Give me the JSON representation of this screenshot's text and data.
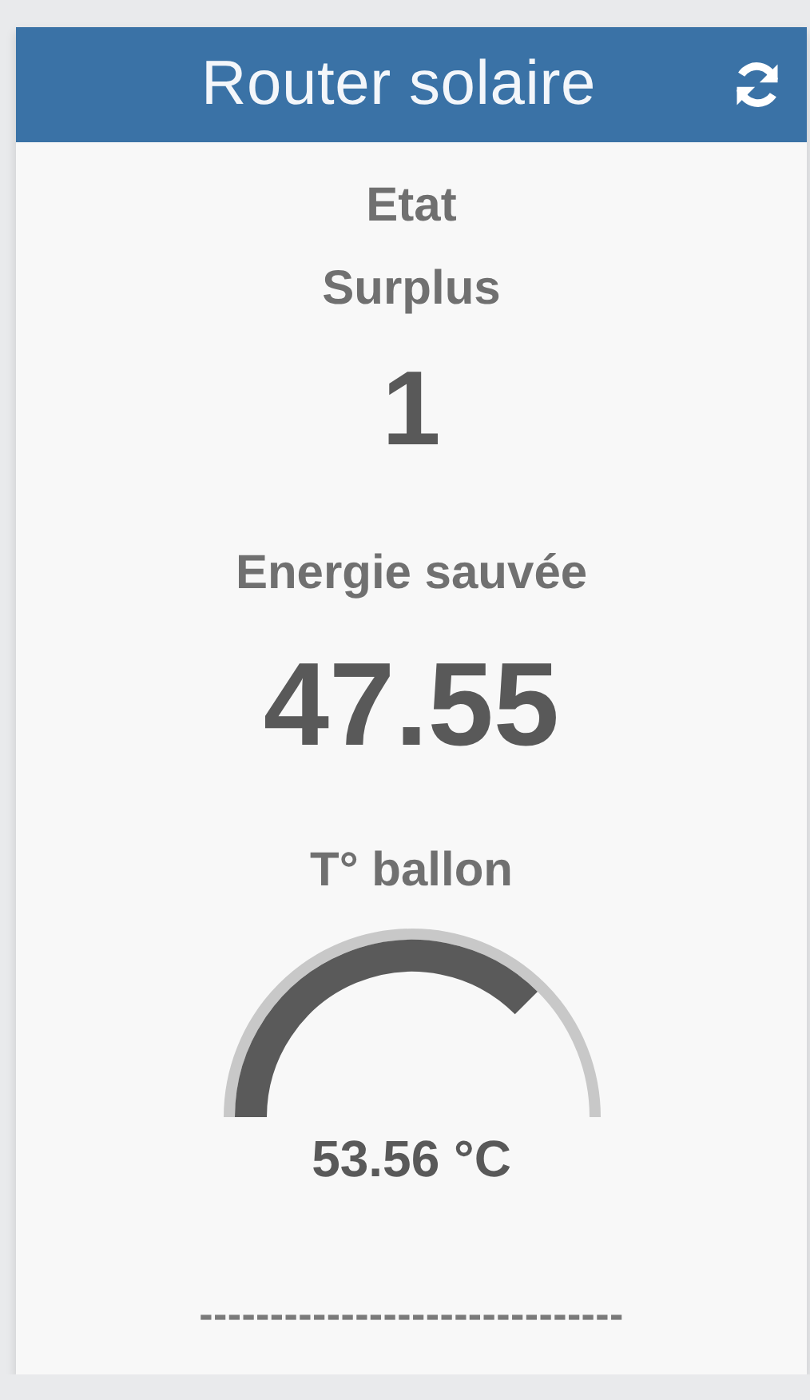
{
  "header": {
    "title": "Router solaire"
  },
  "widgets": [
    {
      "kind": "value",
      "label": "Etat\nSurplus",
      "value": "1"
    },
    {
      "kind": "value",
      "label": "Energie sauvée",
      "value": "47.55"
    },
    {
      "kind": "gauge",
      "label": "T° ballon",
      "reading": "53.56 °C"
    }
  ],
  "footer": "------------------------------"
}
